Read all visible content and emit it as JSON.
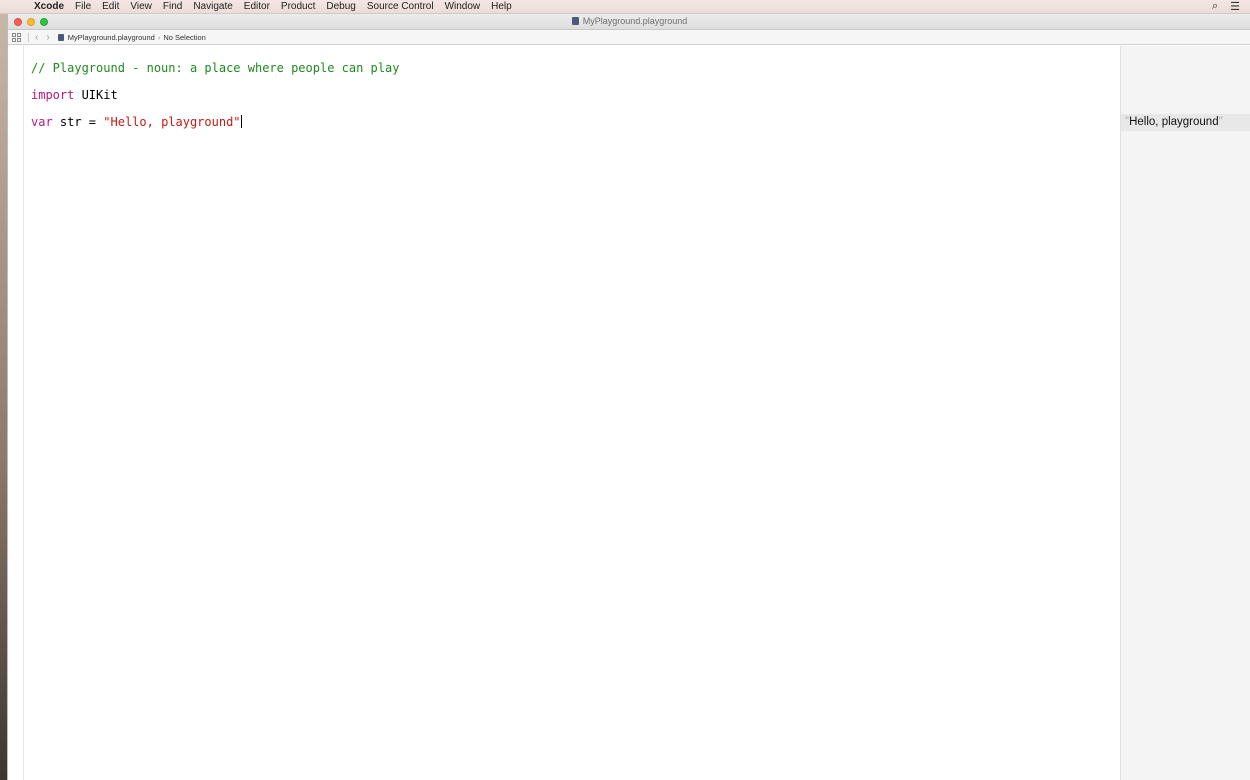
{
  "menubar": {
    "apple": "",
    "items": [
      "Xcode",
      "File",
      "Edit",
      "View",
      "Find",
      "Navigate",
      "Editor",
      "Product",
      "Debug",
      "Source Control",
      "Window",
      "Help"
    ],
    "right_icons": [
      "search-icon",
      "list-icon"
    ]
  },
  "window": {
    "title": "MyPlayground.playground"
  },
  "jumpbar": {
    "file": "MyPlayground.playground",
    "selection": "No Selection"
  },
  "editor": {
    "lines": {
      "comment": "// Playground - noun: a place where people can play",
      "import_kw": "import",
      "import_module": " UIKit",
      "var_kw": "var",
      "var_decl": " str = ",
      "var_value": "\"Hello, playground\""
    }
  },
  "results": {
    "value": "Hello, playground",
    "quote": "\""
  },
  "colors": {
    "comment": "#1e8a1e",
    "keyword": "#b51a7c",
    "string": "#c41a16"
  }
}
